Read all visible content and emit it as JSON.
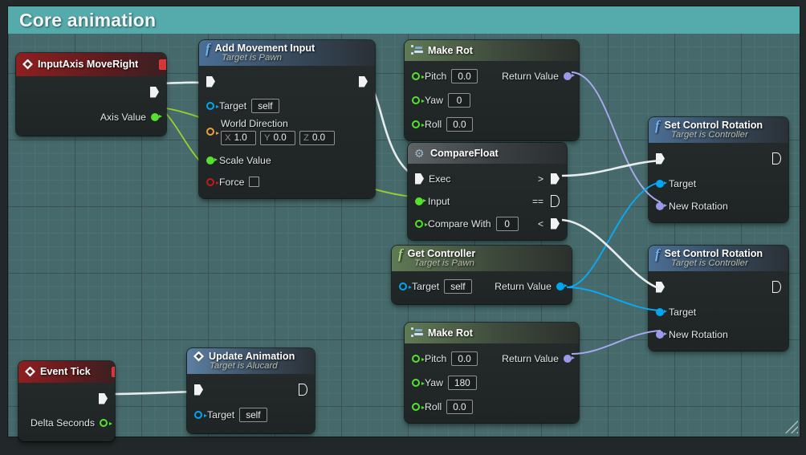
{
  "comment": {
    "title": "Core animation",
    "color": "#55aaab",
    "body_color": "#466a6b"
  },
  "nodes": [
    {
      "id": "input-axis-move-right",
      "title": "InputAxis MoveRight",
      "subtitle": "",
      "kind": "event",
      "icon": "event-diamond-icon",
      "badge": "stop-icon",
      "outputs": [
        {
          "label": "",
          "pin": "exec"
        },
        {
          "label": "Axis Value",
          "pin": "data",
          "color": "#55e22e"
        }
      ],
      "inputs": []
    },
    {
      "id": "add-movement-input",
      "title": "Add Movement Input",
      "subtitle": "Target is Pawn",
      "kind": "function",
      "icon": "function-f-icon",
      "inputs": [
        {
          "label": "",
          "pin": "exec"
        },
        {
          "label": "Target",
          "pin": "data",
          "color": "#00a6f0",
          "value": "self"
        },
        {
          "label": "World Direction",
          "pin": "data",
          "color": "#e8a33d",
          "vector": [
            {
              "axis": "X",
              "value": "1.0"
            },
            {
              "axis": "Y",
              "value": "0.0"
            },
            {
              "axis": "Z",
              "value": "0.0"
            }
          ]
        },
        {
          "label": "Scale Value",
          "pin": "data",
          "color": "#55e22e",
          "filled": true
        },
        {
          "label": "Force",
          "pin": "data",
          "color": "#c01c1c",
          "checkbox": true
        }
      ],
      "outputs": [
        {
          "label": "",
          "pin": "exec"
        }
      ]
    },
    {
      "id": "make-rot-top",
      "title": "Make Rot",
      "subtitle": "",
      "kind": "pure",
      "icon": "rotator-icon",
      "inputs": [
        {
          "label": "Pitch",
          "pin": "data",
          "color": "#55e22e",
          "value": "0.0"
        },
        {
          "label": "Yaw",
          "pin": "data",
          "color": "#55e22e",
          "value": "0"
        },
        {
          "label": "Roll",
          "pin": "data",
          "color": "#55e22e",
          "value": "0.0"
        }
      ],
      "outputs": [
        {
          "label": "Return Value",
          "pin": "data",
          "color": "#9a9ae8",
          "filled": true
        }
      ]
    },
    {
      "id": "compare-float",
      "title": "CompareFloat",
      "subtitle": "",
      "kind": "macro",
      "icon": "gear-icon",
      "inputs": [
        {
          "label": "Exec",
          "pin": "exec"
        },
        {
          "label": "Input",
          "pin": "data",
          "color": "#55e22e",
          "filled": true
        },
        {
          "label": "Compare With",
          "pin": "data",
          "color": "#55e22e",
          "value": "0"
        }
      ],
      "outputs": [
        {
          "label": ">",
          "pin": "exec"
        },
        {
          "label": "==",
          "pin": "exec",
          "hollow": true
        },
        {
          "label": "<",
          "pin": "exec"
        }
      ]
    },
    {
      "id": "get-controller",
      "title": "Get Controller",
      "subtitle": "Target is Pawn",
      "kind": "pure-func",
      "icon": "function-f-icon",
      "inputs": [
        {
          "label": "Target",
          "pin": "data",
          "color": "#00a6f0",
          "value": "self"
        }
      ],
      "outputs": [
        {
          "label": "Return Value",
          "pin": "data",
          "color": "#00a6f0",
          "filled": true
        }
      ]
    },
    {
      "id": "make-rot-bottom",
      "title": "Make Rot",
      "subtitle": "",
      "kind": "pure",
      "icon": "rotator-icon",
      "inputs": [
        {
          "label": "Pitch",
          "pin": "data",
          "color": "#55e22e",
          "value": "0.0"
        },
        {
          "label": "Yaw",
          "pin": "data",
          "color": "#55e22e",
          "value": "180"
        },
        {
          "label": "Roll",
          "pin": "data",
          "color": "#55e22e",
          "value": "0.0"
        }
      ],
      "outputs": [
        {
          "label": "Return Value",
          "pin": "data",
          "color": "#9a9ae8",
          "filled": true
        }
      ]
    },
    {
      "id": "set-control-rotation-top",
      "title": "Set Control Rotation",
      "subtitle": "Target is Controller",
      "kind": "function",
      "icon": "function-f-icon",
      "inputs": [
        {
          "label": "",
          "pin": "exec"
        },
        {
          "label": "Target",
          "pin": "data",
          "color": "#00a6f0",
          "filled": true
        },
        {
          "label": "New Rotation",
          "pin": "data",
          "color": "#9a9ae8",
          "filled": true
        }
      ],
      "outputs": [
        {
          "label": "",
          "pin": "exec",
          "hollow": true
        }
      ]
    },
    {
      "id": "set-control-rotation-bottom",
      "title": "Set Control Rotation",
      "subtitle": "Target is Controller",
      "kind": "function",
      "icon": "function-f-icon",
      "inputs": [
        {
          "label": "",
          "pin": "exec"
        },
        {
          "label": "Target",
          "pin": "data",
          "color": "#00a6f0",
          "filled": true
        },
        {
          "label": "New Rotation",
          "pin": "data",
          "color": "#9a9ae8",
          "filled": true
        }
      ],
      "outputs": [
        {
          "label": "",
          "pin": "exec",
          "hollow": true
        }
      ]
    },
    {
      "id": "event-tick",
      "title": "Event Tick",
      "subtitle": "",
      "kind": "event",
      "icon": "event-diamond-icon",
      "badge": "stop-icon",
      "outputs": [
        {
          "label": "",
          "pin": "exec"
        },
        {
          "label": "Delta Seconds",
          "pin": "data",
          "color": "#55e22e"
        }
      ],
      "inputs": []
    },
    {
      "id": "update-animation",
      "title": "Update Animation",
      "subtitle": "Target is Alucard",
      "kind": "event-call",
      "icon": "event-diamond-icon",
      "inputs": [
        {
          "label": "",
          "pin": "exec"
        },
        {
          "label": "Target",
          "pin": "data",
          "color": "#00a6f0",
          "value": "self"
        }
      ],
      "outputs": [
        {
          "label": "",
          "pin": "exec",
          "hollow": true
        }
      ]
    }
  ],
  "labels": {
    "input_axis_title": "InputAxis MoveRight",
    "axis_value": "Axis Value",
    "add_movement_title": "Add Movement Input",
    "add_movement_sub": "Target is Pawn",
    "target": "Target",
    "self": "self",
    "world_direction": "World Direction",
    "x_axis": "X",
    "x_val": "1.0",
    "y_axis": "Y",
    "y_val": "0.0",
    "z_axis": "Z",
    "z_val": "0.0",
    "scale_value": "Scale Value",
    "force": "Force",
    "make_rot_title": "Make Rot",
    "pitch": "Pitch",
    "pitch_val_top": "0.0",
    "yaw": "Yaw",
    "yaw_val_top": "0",
    "roll": "Roll",
    "roll_val_top": "0.0",
    "return_value": "Return Value",
    "compare_float_title": "CompareFloat",
    "exec": "Exec",
    "input": "Input",
    "compare_with": "Compare With",
    "compare_with_val": "0",
    "op_gt": ">",
    "op_eq": "==",
    "op_lt": "<",
    "get_controller_title": "Get Controller",
    "get_controller_sub": "Target is Pawn",
    "pitch_val_bot": "0.0",
    "yaw_val_bot": "180",
    "roll_val_bot": "0.0",
    "set_control_rotation_title": "Set Control Rotation",
    "set_control_rotation_sub": "Target is Controller",
    "new_rotation": "New Rotation",
    "event_tick_title": "Event Tick",
    "delta_seconds": "Delta Seconds",
    "update_animation_title": "Update Animation",
    "update_animation_sub": "Target is Alucard"
  }
}
